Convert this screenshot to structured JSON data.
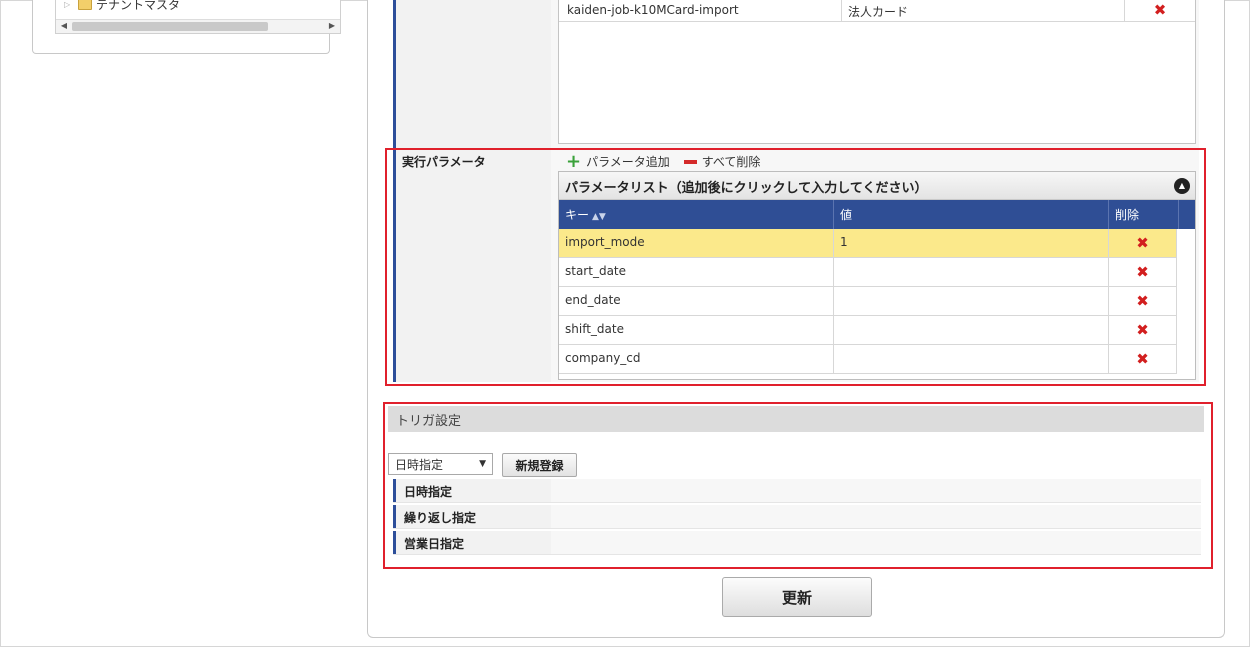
{
  "tree": {
    "item_label": "テナントマスタ"
  },
  "jobs": {
    "rows": [
      {
        "job_id": "kaiden-job-k10MCard-import",
        "name": "法人カード"
      }
    ]
  },
  "params": {
    "section_label": "実行パラメータ",
    "add_label": "パラメータ追加",
    "delete_all_label": "すべて削除",
    "list_title": "パラメータリスト（追加後にクリックして入力してください）",
    "columns": {
      "key": "キー",
      "value": "値",
      "delete": "削除"
    },
    "rows": [
      {
        "key": "import_mode",
        "value": "1",
        "selected": true
      },
      {
        "key": "start_date",
        "value": ""
      },
      {
        "key": "end_date",
        "value": ""
      },
      {
        "key": "shift_date",
        "value": ""
      },
      {
        "key": "company_cd",
        "value": ""
      }
    ]
  },
  "trigger": {
    "section_title": "トリガ設定",
    "select_value": "日時指定",
    "new_button": "新規登録",
    "rows": [
      {
        "label": "日時指定"
      },
      {
        "label": "繰り返し指定"
      },
      {
        "label": "営業日指定"
      }
    ]
  },
  "actions": {
    "update_label": "更新"
  },
  "colors": {
    "header_blue": "#2f4e95",
    "highlight_red": "#e0202c",
    "selected_row": "#fbe98b",
    "add_green": "#3aa13a",
    "delete_red": "#d21f1f"
  }
}
